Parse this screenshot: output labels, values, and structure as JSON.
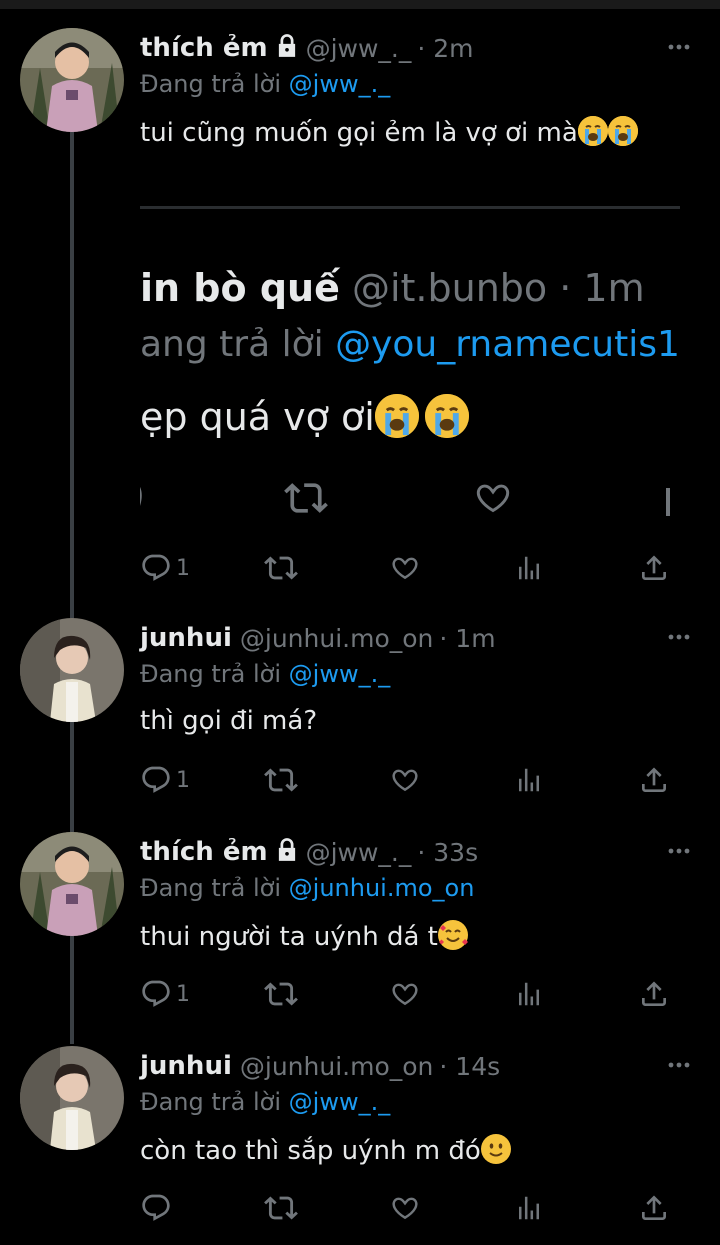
{
  "tweets": [
    {
      "name": "thích ẻm",
      "protected": true,
      "handle": "@jww_._",
      "time": "· 2m",
      "reply_prefix": "Đang trả lời",
      "reply_to": "@jww_._",
      "text": "tui cũng muốn gọi ẻm là vợ ơi mà",
      "emojis": [
        "loudly-crying-face",
        "loudly-crying-face"
      ],
      "counts": {
        "replies": "1"
      },
      "quoted": {
        "name": "in bò quế",
        "handle": "@it.bunbo",
        "time": "· 1m",
        "reply_prefix": "ang trả lời",
        "reply_to": "@you_rnamecutis1",
        "text": "ẹp quá vợ ơi",
        "emojis": [
          "loudly-crying-face",
          "loudly-crying-face"
        ]
      }
    },
    {
      "name": "junhui",
      "protected": false,
      "handle": "@junhui.mo_on",
      "time": "· 1m",
      "reply_prefix": "Đang trả lời",
      "reply_to": "@jww_._",
      "text": "thì gọi đi má?",
      "counts": {
        "replies": "1"
      }
    },
    {
      "name": "thích ẻm",
      "protected": true,
      "handle": "@jww_._",
      "time": "· 33s",
      "reply_prefix": "Đang trả lời",
      "reply_to": "@junhui.mo_on",
      "text": "thui người ta uýnh dá t",
      "emojis": [
        "smiling-face-with-hearts"
      ],
      "counts": {
        "replies": "1"
      }
    },
    {
      "name": "junhui",
      "protected": false,
      "handle": "@junhui.mo_on",
      "time": "· 14s",
      "reply_prefix": "Đang trả lời",
      "reply_to": "@jww_._",
      "text": "còn tao thì sắp uýnh m đó",
      "emojis": [
        "slightly-smiling-face"
      ],
      "counts": {
        "replies": ""
      }
    }
  ],
  "colors": {
    "background": "#000000",
    "text_primary": "#e7e9ea",
    "text_secondary": "#71767b",
    "link": "#1d9bf0",
    "thread_line": "#3a3f44"
  }
}
